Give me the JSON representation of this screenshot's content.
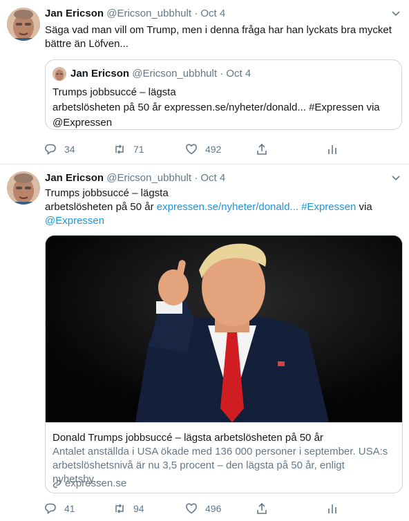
{
  "tweets": [
    {
      "name": "Jan Ericson",
      "handle": "@Ericson_ubbhult",
      "sep": "·",
      "date": "Oct 4",
      "text": "Säga vad man vill om Trump, men i denna fråga har han lyckats bra mycket bättre än Löfven...",
      "quote": {
        "name": "Jan Ericson",
        "handle": "@Ericson_ubbhult",
        "sep": "·",
        "date": "Oct 4",
        "line1": "Trumps jobbsuccé – lägsta",
        "line2": "arbetslösheten på 50 år expressen.se/nyheter/donald... #Expressen via",
        "line3": "@Expressen"
      },
      "replies": "34",
      "retweets": "71",
      "likes": "492"
    },
    {
      "name": "Jan Ericson",
      "handle": "@Ericson_ubbhult",
      "sep": "·",
      "date": "Oct 4",
      "line1": "Trumps jobbsuccé – lägsta",
      "line2_plain": "arbetslösheten på 50 år ",
      "link_url": "expressen.se/nyheter/donald...",
      "hashtag": "#Expressen",
      "via": "via",
      "mention": "@Expressen",
      "card": {
        "title": "Donald Trumps jobbsuccé – lägsta arbetslösheten på 50 år",
        "description": "Antalet anställda i USA ökade med 136 000 personer i september. USA:s arbetslöshetsnivå är nu 3,5 procent – den lägsta på 50 år, enligt nyhetsby...",
        "domain": "expressen.se"
      },
      "replies": "41",
      "retweets": "94",
      "likes": "496"
    }
  ],
  "icons": {
    "reply": "reply-icon",
    "retweet": "retweet-icon",
    "like": "heart-icon",
    "share": "share-icon",
    "analytics": "analytics-icon",
    "caret": "chevron-down-icon",
    "link": "link-icon"
  },
  "colors": {
    "link": "#1b95e0",
    "secondary": "#657786",
    "border": "#e6ecf0"
  }
}
